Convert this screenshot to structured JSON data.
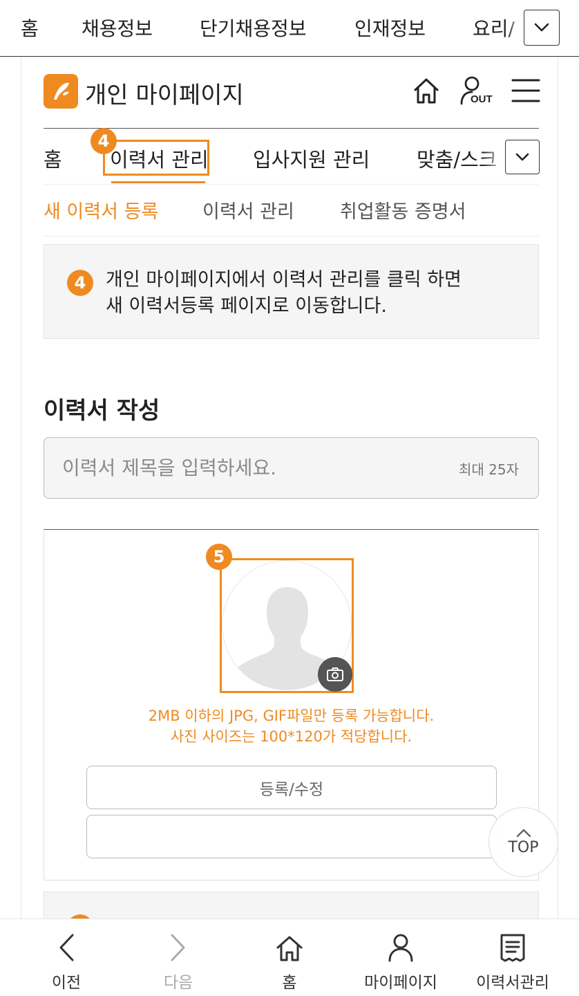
{
  "topnav": {
    "items": [
      "홈",
      "채용정보",
      "단기채용정보",
      "인재정보",
      "요리/"
    ],
    "more_icon": "chevron-down-icon"
  },
  "header": {
    "title": "개인 마이페이지",
    "logo_icon": "fish-logo-icon",
    "home_icon": "home-icon",
    "logout_icon": "logout-icon",
    "logout_text": "OUT",
    "menu_icon": "hamburger-menu-icon"
  },
  "tabs": {
    "items": [
      "홈",
      "이력서 관리",
      "입사지원 관리",
      "맞춤/스크"
    ],
    "active_index": 1,
    "step_badge": "4",
    "more_icon": "chevron-down-icon"
  },
  "subtabs": {
    "items": [
      "새 이력서 등록",
      "이력서 관리",
      "취업활동 증명서"
    ],
    "active_index": 0
  },
  "notice": {
    "badge": "4",
    "line1": "개인 마이페이지에서 이력서 관리를 클릭 하면",
    "line2": "새 이력서등록 페이지로 이동합니다."
  },
  "resume": {
    "section_title": "이력서 작성",
    "title_placeholder": "이력서 제목을 입력하세요.",
    "title_value": "",
    "max_hint": "최대 25자"
  },
  "photo": {
    "badge": "5",
    "camera_icon": "camera-icon",
    "hint_line1": "2MB 이하의 JPG, GIF파일만 등록 가능합니다.",
    "hint_line2": "사진 사이즈는 100*120가 적당합니다.",
    "register_button": "등록/수정",
    "second_button": ""
  },
  "top_button": {
    "label": "TOP",
    "icon": "chevron-up-icon"
  },
  "bottombar": {
    "items": [
      {
        "label": "이전",
        "icon": "chevron-left-icon",
        "enabled": true
      },
      {
        "label": "다음",
        "icon": "chevron-right-icon",
        "enabled": false
      },
      {
        "label": "홈",
        "icon": "home-icon",
        "enabled": true
      },
      {
        "label": "마이페이지",
        "icon": "person-icon",
        "enabled": true
      },
      {
        "label": "이력서관리",
        "icon": "document-list-icon",
        "enabled": true
      }
    ]
  },
  "colors": {
    "accent": "#ef8a21",
    "panel_bg": "#f5f5f5",
    "text": "#222222",
    "disabled": "#aaaaaa"
  }
}
